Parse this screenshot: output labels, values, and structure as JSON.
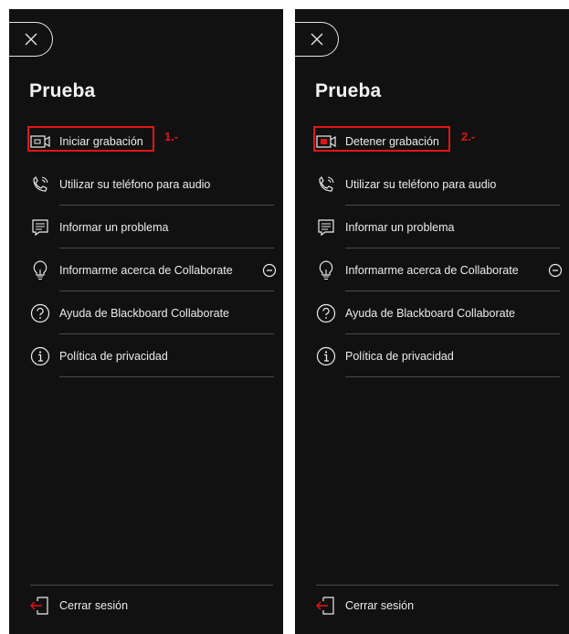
{
  "panels": [
    {
      "title": "Prueba",
      "step_note": "1.-",
      "items": [
        {
          "label": "Iniciar grabación"
        },
        {
          "label": "Utilizar su teléfono para audio"
        },
        {
          "label": "Informar un problema"
        },
        {
          "label": "Informarme acerca de Collaborate"
        },
        {
          "label": "Ayuda de Blackboard Collaborate"
        },
        {
          "label": "Política de privacidad"
        }
      ],
      "signout_label": "Cerrar sesión"
    },
    {
      "title": "Prueba",
      "step_note": "2.-",
      "items": [
        {
          "label": "Detener grabación"
        },
        {
          "label": "Utilizar su teléfono para audio"
        },
        {
          "label": "Informar un problema"
        },
        {
          "label": "Informarme acerca de Collaborate"
        },
        {
          "label": "Ayuda de Blackboard Collaborate"
        },
        {
          "label": "Política de privacidad"
        }
      ],
      "signout_label": "Cerrar sesión"
    }
  ],
  "icons": [
    "close-icon",
    "camera-icon",
    "phone-icon",
    "feedback-icon",
    "lightbulb-icon",
    "expand-icon",
    "help-icon",
    "info-icon",
    "exit-icon"
  ],
  "colors": {
    "background": "#111112",
    "text": "#ececec",
    "separator": "#4a4a4a",
    "annotation": "#e21515",
    "recording_active": "#e21515"
  }
}
